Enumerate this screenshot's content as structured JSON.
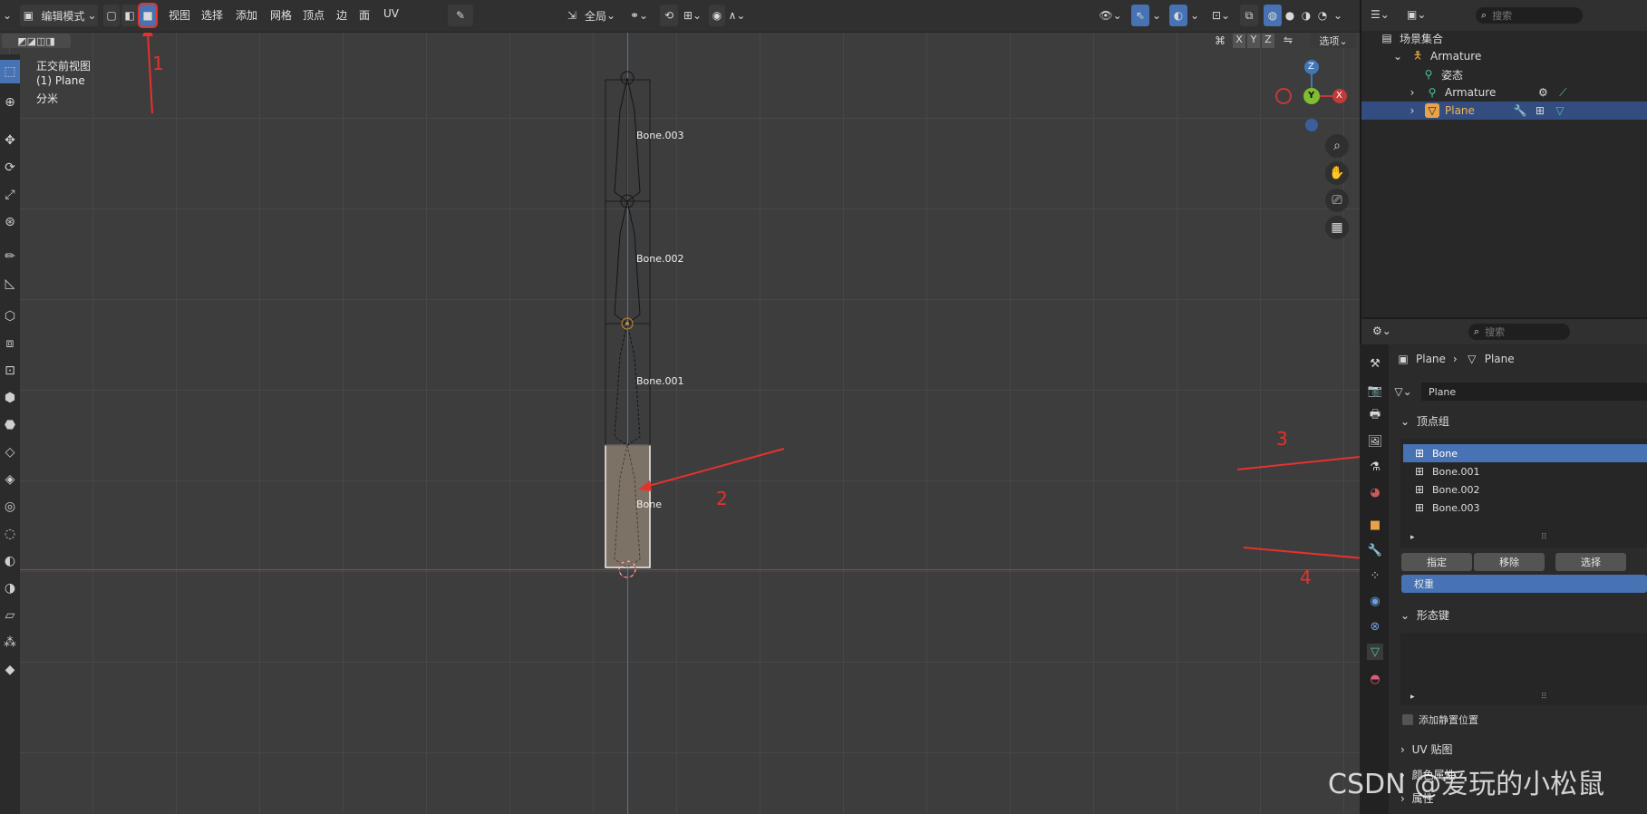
{
  "header": {
    "mode_label": "编辑模式",
    "menus": [
      "视图",
      "选择",
      "添加",
      "网格",
      "顶点",
      "边",
      "面",
      "UV"
    ],
    "transform_orientation": "全局",
    "options_label": "选项",
    "axes": [
      "X",
      "Y",
      "Z"
    ]
  },
  "viewport": {
    "view_name": "正交前视图",
    "object_line": "(1) Plane",
    "units": "分米",
    "bones": [
      "Bone.003",
      "Bone.002",
      "Bone.001",
      "Bone"
    ],
    "gizmo_axes": {
      "z": "Z",
      "y": "Y",
      "x": "X"
    }
  },
  "annotations": [
    "1",
    "2",
    "3",
    "4"
  ],
  "outliner": {
    "search_placeholder": "搜索",
    "rows": [
      {
        "label": "场景集合",
        "icon": "collection-icon"
      },
      {
        "label": "Armature",
        "icon": "armature-icon"
      },
      {
        "label": "姿态",
        "icon": "pose-icon"
      },
      {
        "label": "Armature",
        "icon": "armature-data-icon"
      },
      {
        "label": "Plane",
        "icon": "mesh-icon"
      }
    ]
  },
  "properties": {
    "search_placeholder": "搜索",
    "breadcrumb": [
      "Plane",
      "Plane"
    ],
    "mesh_name": "Plane",
    "vertex_groups_title": "顶点组",
    "vertex_groups": [
      "Bone",
      "Bone.001",
      "Bone.002",
      "Bone.003"
    ],
    "buttons": {
      "assign": "指定",
      "remove": "移除",
      "select": "选择"
    },
    "weight_label": "权重",
    "shape_keys_title": "形态键",
    "add_rest_position": "添加静置位置",
    "uv_maps": "UV 贴图",
    "color_attributes": "颜色属性",
    "attributes": "属性"
  },
  "watermark": "CSDN @爱玩的小松鼠",
  "colors": {
    "accent": "#4772b3",
    "annotation": "#e5322d"
  }
}
